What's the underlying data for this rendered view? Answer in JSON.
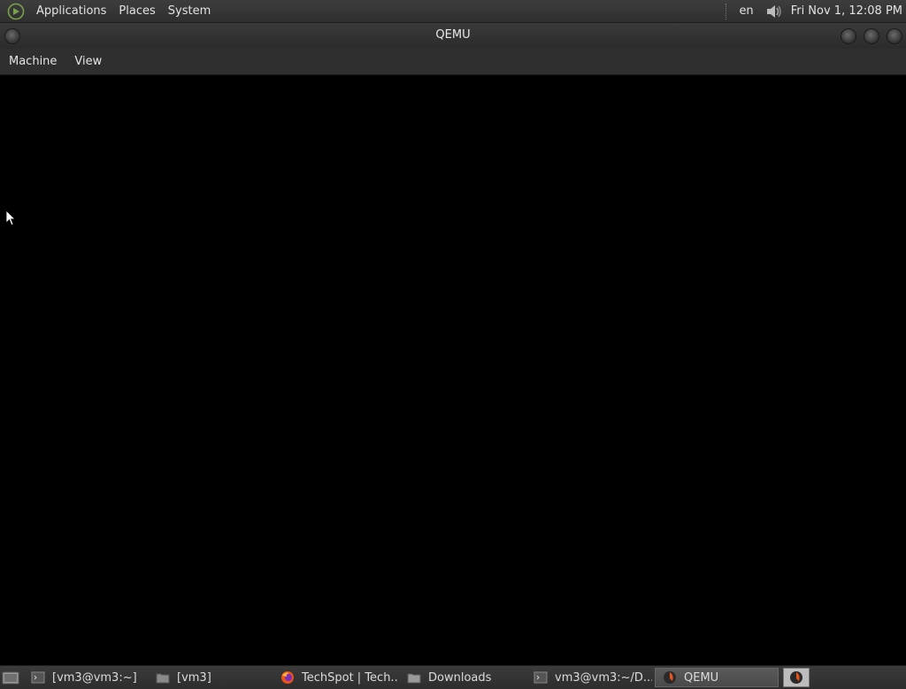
{
  "top_panel": {
    "menus": [
      "Applications",
      "Places",
      "System"
    ],
    "language": "en",
    "clock": "Fri Nov 1, 12:08 PM"
  },
  "window": {
    "title": "QEMU",
    "menus": [
      "Machine",
      "View"
    ]
  },
  "taskbar": {
    "tasks": [
      {
        "label": "[vm3@vm3:~]",
        "icon": "terminal-icon"
      },
      {
        "label": "[vm3]",
        "icon": "folder-icon"
      },
      {
        "label": "TechSpot | Tech...",
        "icon": "firefox-icon"
      },
      {
        "label": "Downloads",
        "icon": "folder-icon"
      },
      {
        "label": "vm3@vm3:~/D...",
        "icon": "terminal-icon"
      },
      {
        "label": "QEMU",
        "icon": "qemu-icon",
        "active": true
      }
    ]
  },
  "colors": {
    "panel": "#333333",
    "screen": "#000000",
    "text": "#e2e2e2"
  }
}
